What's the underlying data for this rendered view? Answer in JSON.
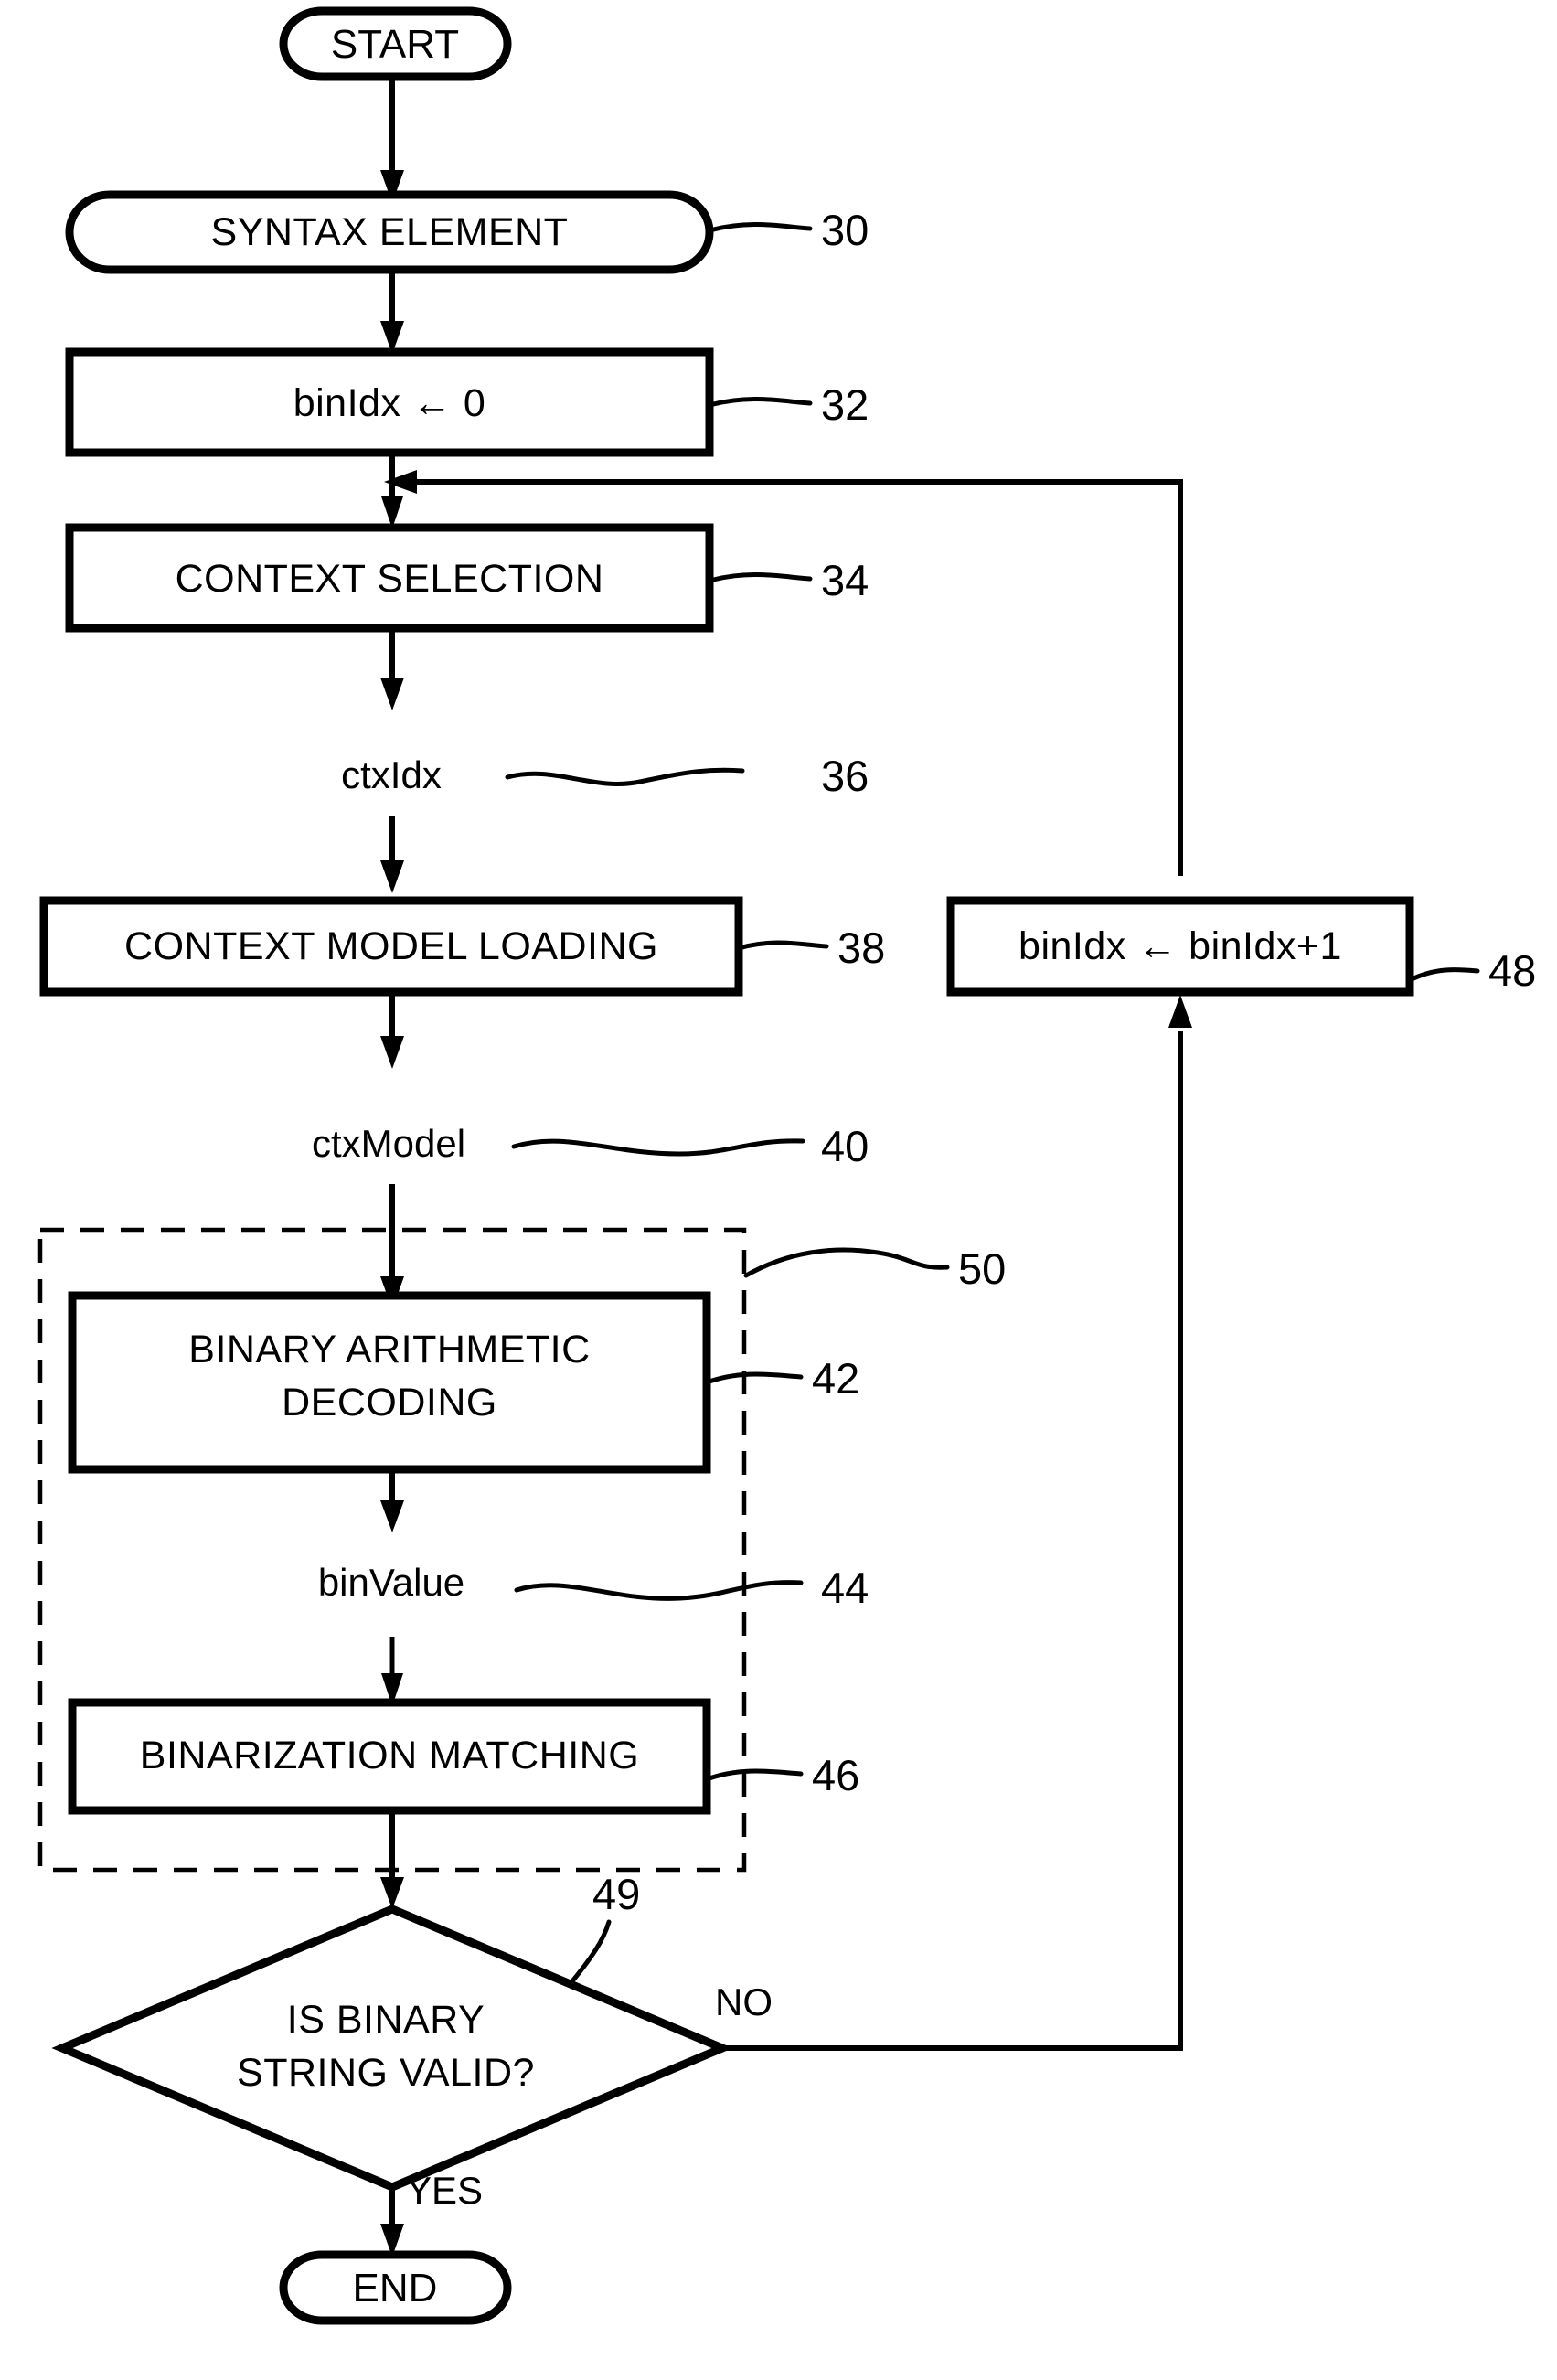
{
  "diagram": {
    "title": "CABAC Decoding Process Flowchart",
    "nodes": {
      "start": {
        "label": "START",
        "shape": "terminator"
      },
      "syntax_element": {
        "label": "SYNTAX ELEMENT",
        "shape": "stadium",
        "ref": "30"
      },
      "bin_idx_init": {
        "label": "binIdx ← 0",
        "shape": "process",
        "ref": "32"
      },
      "context_selection": {
        "label": "CONTEXT SELECTION",
        "shape": "process",
        "ref": "34"
      },
      "ctx_idx": {
        "label": "ctxIdx",
        "shape": "data-label",
        "ref": "36"
      },
      "context_model_loading": {
        "label": "CONTEXT MODEL LOADING",
        "shape": "process",
        "ref": "38"
      },
      "ctx_model": {
        "label": "ctxModel",
        "shape": "data-label",
        "ref": "40"
      },
      "binary_arithmetic_decoding": {
        "label_line1": "BINARY ARITHMETIC",
        "label_line2": "DECODING",
        "shape": "process",
        "ref": "42"
      },
      "bin_value": {
        "label": "binValue",
        "shape": "data-label",
        "ref": "44"
      },
      "binarization_matching": {
        "label": "BINARIZATION MATCHING",
        "shape": "process",
        "ref": "46"
      },
      "bin_idx_increment": {
        "label": "binIdx ← binIdx+1",
        "shape": "process",
        "ref": "48"
      },
      "decision": {
        "label_line1": "IS BINARY",
        "label_line2": "STRING VALID?",
        "shape": "diamond",
        "ref": "49"
      },
      "dashed_group": {
        "ref": "50",
        "shape": "dashed-group"
      },
      "end": {
        "label": "END",
        "shape": "terminator"
      }
    },
    "branch_labels": {
      "no": "NO",
      "yes": "YES"
    },
    "colors": {
      "stroke": "#000000",
      "background": "#ffffff"
    }
  }
}
